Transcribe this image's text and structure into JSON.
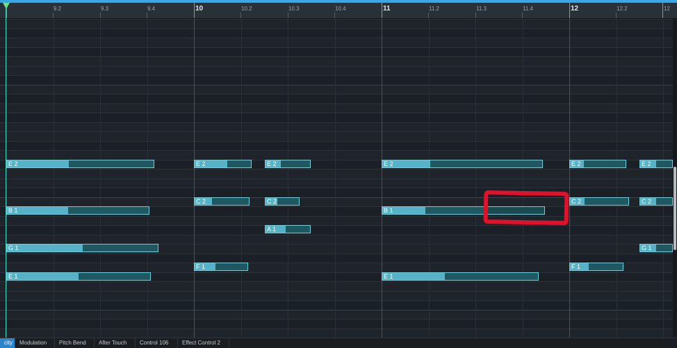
{
  "ruler": {
    "labels": [
      {
        "text": "9.2"
      },
      {
        "text": "9.3"
      },
      {
        "text": "9.4"
      },
      {
        "text": "10"
      },
      {
        "text": "10.2"
      },
      {
        "text": "10.3"
      },
      {
        "text": "10.4"
      },
      {
        "text": "11"
      },
      {
        "text": "11.2"
      },
      {
        "text": "11.3"
      },
      {
        "text": "11.4"
      },
      {
        "text": "12"
      },
      {
        "text": "12.2"
      },
      {
        "text": "12"
      }
    ]
  },
  "notes": [
    {
      "label": "E 2",
      "velocity": 0.42
    },
    {
      "label": "E 2",
      "velocity": 0.58
    },
    {
      "label": "E 2",
      "velocity": 0.35
    },
    {
      "label": "E 2",
      "velocity": 0.3
    },
    {
      "label": "E 2",
      "velocity": 0.25
    },
    {
      "label": "E 2",
      "velocity": 0.5
    },
    {
      "label": "C 2",
      "velocity": 0.32
    },
    {
      "label": "C 2",
      "velocity": 0.35
    },
    {
      "label": "C 2",
      "velocity": 0.25
    },
    {
      "label": "C 2",
      "velocity": 0.5
    },
    {
      "label": "B 1",
      "velocity": 0.43
    },
    {
      "label": "B 1",
      "velocity": 0.27
    },
    {
      "label": "",
      "velocity": 0.0
    },
    {
      "label": "A 1",
      "velocity": 0.45
    },
    {
      "label": "G 1",
      "velocity": 0.5
    },
    {
      "label": "G 1",
      "velocity": 0.5
    },
    {
      "label": "F 1",
      "velocity": 0.4
    },
    {
      "label": "F 1",
      "velocity": 0.35
    },
    {
      "label": "E 1",
      "velocity": 0.5
    },
    {
      "label": "E 1",
      "velocity": 0.4
    }
  ],
  "tabs": [
    {
      "label": "city",
      "active": true
    },
    {
      "label": "Modulation",
      "active": false
    },
    {
      "label": "Pitch Bend",
      "active": false
    },
    {
      "label": "After Touch",
      "active": false
    },
    {
      "label": "Control 106",
      "active": false
    },
    {
      "label": "Effect Control 2",
      "active": false
    }
  ],
  "colors": {
    "accent": "#39a7e5",
    "note_fill": "#56b3c7",
    "note_body": "#1f5860",
    "highlight": "#e0112a"
  }
}
